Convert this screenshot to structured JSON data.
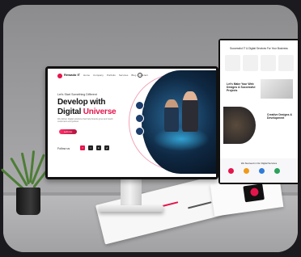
{
  "site": {
    "logo": "Rewado IT",
    "nav": [
      "Home",
      "Company",
      "Portfolio",
      "Services",
      "Blog",
      "Contact"
    ],
    "hero": {
      "kicker": "Let's Start Something Different",
      "line1": "Develop with",
      "line2_plain": "Digital",
      "line2_accent": "Universe",
      "description": "We deliver digital solutions that help brands grow and reach customers everywhere.",
      "cta": "Let's Go"
    },
    "follow_label": "Follow us",
    "socials": [
      "f",
      "t",
      "in",
      "yt"
    ]
  },
  "second_page": {
    "title": "Successful IT & Digital Services For Your Business",
    "heading1": "Let's Make Your Web Designs & Successful Projects",
    "heading2": "Creative Designs & Development",
    "banner_title": "We Succeed in Our Digital Services"
  },
  "colors": {
    "accent": "#e4154b",
    "dark": "#111111",
    "wall": "#9a9a9c"
  }
}
